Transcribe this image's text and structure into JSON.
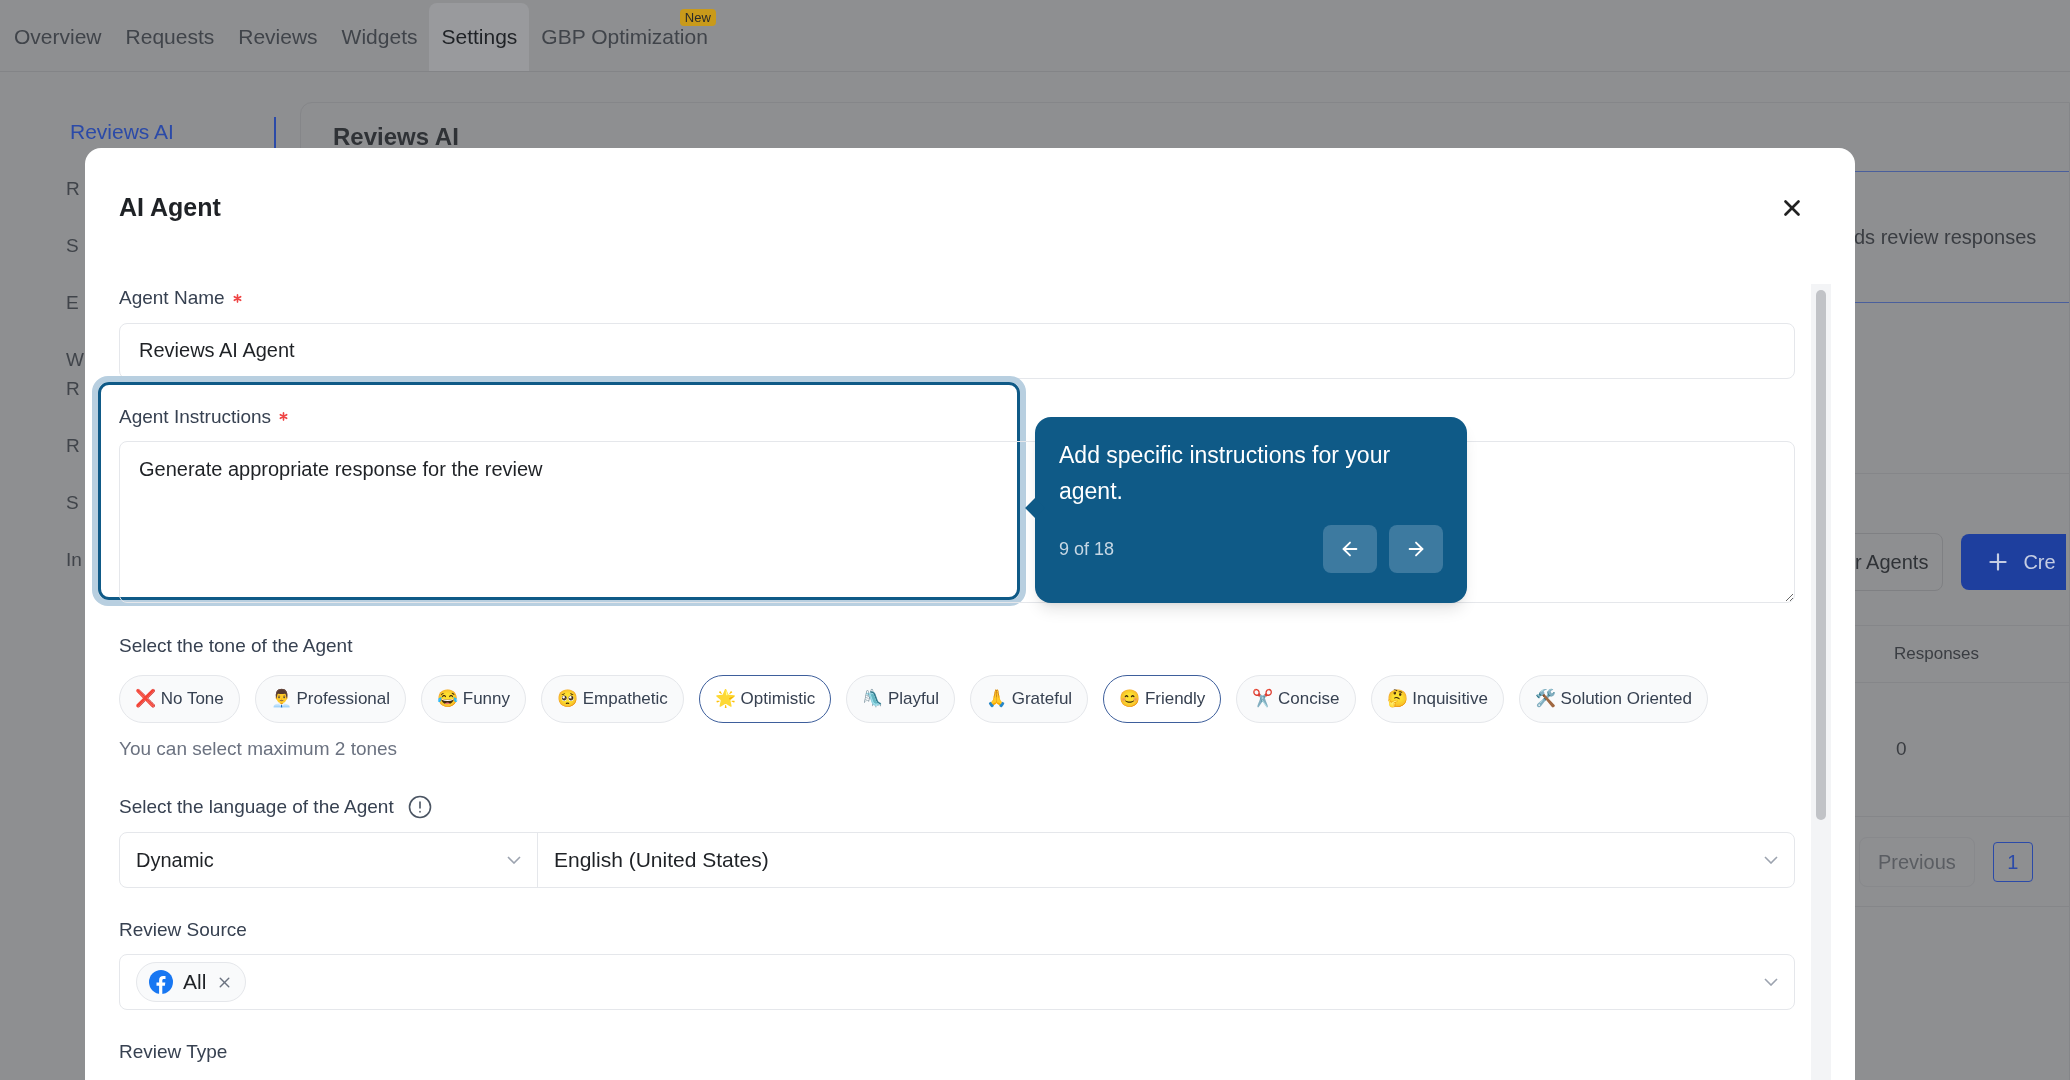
{
  "nav_tabs": [
    {
      "label": "Overview",
      "selected": false
    },
    {
      "label": "Requests",
      "selected": false
    },
    {
      "label": "Reviews",
      "selected": false
    },
    {
      "label": "Widgets",
      "selected": false
    },
    {
      "label": "Settings",
      "selected": true
    },
    {
      "label": "GBP Optimization",
      "selected": false,
      "badge": "New"
    }
  ],
  "sidebar": {
    "items": [
      {
        "label": "Reviews AI",
        "selected": true
      },
      {
        "label": "R",
        "selected": false
      },
      {
        "label": "S",
        "selected": false
      },
      {
        "label": "E",
        "selected": false
      },
      {
        "label": "W R",
        "selected": false
      },
      {
        "label": "R",
        "selected": false
      },
      {
        "label": "S",
        "selected": false
      },
      {
        "label": "In",
        "selected": false
      }
    ]
  },
  "content": {
    "heading": "Reviews AI",
    "description": "ds review responses",
    "agents_button": "r Agents",
    "create_button": "Cre",
    "table_column": "Responses",
    "table_value": "0",
    "previous_button": "Previous",
    "page": "1"
  },
  "modal": {
    "title": "AI Agent",
    "agent_name": {
      "label": "Agent Name",
      "required": true,
      "value": "Reviews AI Agent"
    },
    "agent_instructions": {
      "label": "Agent Instructions",
      "required": true,
      "value": "Generate appropriate response for the review",
      "highlighted": true
    },
    "tone": {
      "label": "Select the tone of the Agent",
      "hint": "You can select maximum 2 tones",
      "options": [
        {
          "emoji": "❌",
          "label": "No Tone",
          "selected": false
        },
        {
          "emoji": "👨‍💼",
          "label": "Professional",
          "selected": false
        },
        {
          "emoji": "😂",
          "label": "Funny",
          "selected": false
        },
        {
          "emoji": "🥺",
          "label": "Empathetic",
          "selected": false
        },
        {
          "emoji": "🌟",
          "label": "Optimistic",
          "selected": true
        },
        {
          "emoji": "🛝",
          "label": "Playful",
          "selected": false
        },
        {
          "emoji": "🙏",
          "label": "Grateful",
          "selected": false
        },
        {
          "emoji": "😊",
          "label": "Friendly",
          "selected": true
        },
        {
          "emoji": "✂️",
          "label": "Concise",
          "selected": false
        },
        {
          "emoji": "🤔",
          "label": "Inquisitive",
          "selected": false
        },
        {
          "emoji": "🛠️",
          "label": "Solution Oriented",
          "selected": false
        }
      ]
    },
    "language": {
      "label": "Select the language of the Agent",
      "mode": "Dynamic",
      "value": "English (United States)"
    },
    "review_source": {
      "label": "Review Source",
      "tags": [
        "All"
      ]
    },
    "review_type": {
      "label": "Review Type"
    }
  },
  "tour_tooltip": {
    "text": "Add specific instructions for your agent.",
    "step": "9 of 18"
  }
}
